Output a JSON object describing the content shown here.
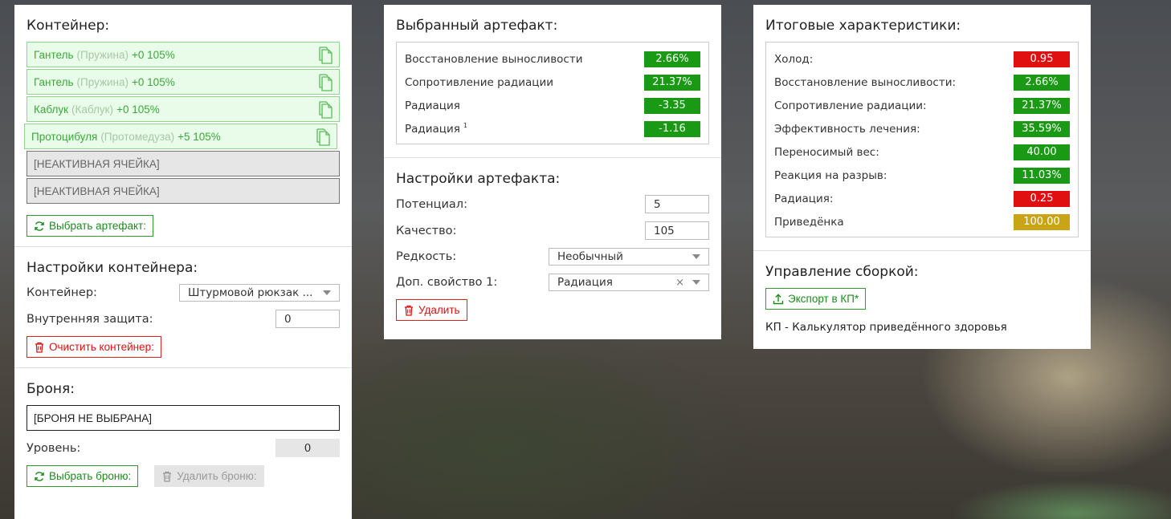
{
  "container_panel": {
    "title": "Контейнер:",
    "slots": [
      {
        "name": "Гантель",
        "origin": "(Пружина)",
        "stats": "+0 105%"
      },
      {
        "name": "Гантель",
        "origin": "(Пружина)",
        "stats": "+0 105%"
      },
      {
        "name": "Каблук",
        "origin": "(Каблук)",
        "stats": "+0 105%"
      },
      {
        "name": "Протоцибуля",
        "origin": "(Протомедуза)",
        "stats": "+5 105%"
      }
    ],
    "inactive_slots": [
      "[НЕАКТИВНАЯ ЯЧЕЙКА]",
      "[НЕАКТИВНАЯ ЯЧЕЙКА]"
    ],
    "choose_button": "Выбрать артефакт:"
  },
  "container_settings": {
    "title": "Настройки контейнера:",
    "container_label": "Контейнер:",
    "container_value": "Штурмовой рюкзак ...",
    "protection_label": "Внутренняя защита:",
    "protection_value": "0",
    "clear_button": "Очистить контейнер:"
  },
  "armor": {
    "title": "Броня:",
    "field_value": "[БРОНЯ НЕ ВЫБРАНА]",
    "level_label": "Уровень:",
    "level_value": "0",
    "choose_button": "Выбрать броню:",
    "delete_button": "Удалить броню:"
  },
  "selected_artifact": {
    "title": "Выбранный артефакт:",
    "stats": [
      {
        "label": "Восстановление выносливости",
        "value": "2.66%",
        "color": "#1a9a14"
      },
      {
        "label": "Сопротивление радиации",
        "value": "21.37%",
        "color": "#1a9a14"
      },
      {
        "label": "Радиация",
        "value": "-3.35",
        "color": "#1a9a14"
      },
      {
        "label": "Радиация",
        "sup": "1",
        "value": "-1.16",
        "color": "#1a9a14"
      }
    ]
  },
  "artifact_settings": {
    "title": "Настройки артефакта:",
    "potential_label": "Потенциал:",
    "potential_value": "5",
    "quality_label": "Качество:",
    "quality_value": "105",
    "rarity_label": "Редкость:",
    "rarity_value": "Необычный",
    "extra_label": "Доп. свойство 1:",
    "extra_value": "Радиация",
    "clear_symbol": "×",
    "delete_button": "Удалить"
  },
  "totals": {
    "title": "Итоговые характеристики:",
    "stats": [
      {
        "label": "Холод:",
        "value": "0.95",
        "color": "#e01010"
      },
      {
        "label": "Восстановление выносливости:",
        "value": "2.66%",
        "color": "#1a9a14"
      },
      {
        "label": "Сопротивление радиации:",
        "value": "21.37%",
        "color": "#1a9a14"
      },
      {
        "label": "Эффективность лечения:",
        "value": "35.59%",
        "color": "#1a9a14"
      },
      {
        "label": "Переносимый вес:",
        "value": "40.00",
        "color": "#1a9a14"
      },
      {
        "label": "Реакция на разрыв:",
        "value": "11.03%",
        "color": "#1a9a14"
      },
      {
        "label": "Радиация:",
        "value": "0.25",
        "color": "#e01010"
      },
      {
        "label": "Приведёнка",
        "value": "100.00",
        "color": "#c9a515"
      }
    ]
  },
  "build_management": {
    "title": "Управление сборкой:",
    "export_button": "Экспорт в КП*",
    "note": "КП - Калькулятор приведённого здоровья"
  }
}
